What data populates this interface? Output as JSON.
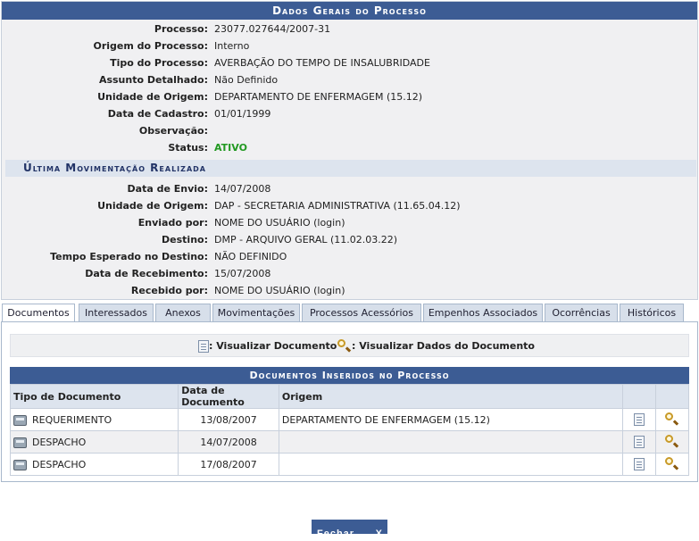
{
  "panel": {
    "title": "Dados Gerais do Processo",
    "fields": [
      {
        "label": "Processo:",
        "value": "23077.027644/2007-31"
      },
      {
        "label": "Origem do Processo:",
        "value": "Interno"
      },
      {
        "label": "Tipo do Processo:",
        "value": "AVERBAÇÃO DO TEMPO DE INSALUBRIDADE"
      },
      {
        "label": "Assunto Detalhado:",
        "value": "Não Definido"
      },
      {
        "label": "Unidade de Origem:",
        "value": "DEPARTAMENTO DE ENFERMAGEM (15.12)"
      },
      {
        "label": "Data de Cadastro:",
        "value": "01/01/1999"
      },
      {
        "label": "Observação:",
        "value": ""
      },
      {
        "label": "Status:",
        "value": "ATIVO"
      }
    ],
    "status_color": "#229922",
    "movement": {
      "title": "Última Movimentação Realizada",
      "fields": [
        {
          "label": "Data de Envio:",
          "value": "14/07/2008"
        },
        {
          "label": "Unidade de Origem:",
          "value": "DAP - SECRETARIA ADMINISTRATIVA (11.65.04.12)"
        },
        {
          "label": "Enviado por:",
          "value": "NOME DO USUÁRIO (login)"
        },
        {
          "label": "Destino:",
          "value": "DMP - ARQUIVO GERAL (11.02.03.22)"
        },
        {
          "label": "Tempo Esperado no Destino:",
          "value": "NÃO DEFINIDO"
        },
        {
          "label": "Data de Recebimento:",
          "value": "15/07/2008"
        },
        {
          "label": "Recebido por:",
          "value": "NOME DO USUÁRIO (login)"
        }
      ]
    }
  },
  "tabs": [
    {
      "label": "Documentos",
      "active": true
    },
    {
      "label": "Interessados"
    },
    {
      "label": "Anexos"
    },
    {
      "label": "Movimentações"
    },
    {
      "label": "Processos Acessórios"
    },
    {
      "label": "Empenhos Associados"
    },
    {
      "label": "Ocorrências"
    },
    {
      "label": "Históricos"
    }
  ],
  "legend": {
    "view_document": ": Visualizar Documento",
    "view_data": ": Visualizar Dados do Documento"
  },
  "documents": {
    "title": "Documentos Inseridos no Processo",
    "columns": [
      "Tipo de Documento",
      "Data de Documento",
      "Origem"
    ],
    "rows": [
      {
        "tipo": "REQUERIMENTO",
        "data": "13/08/2007",
        "origem": "DEPARTAMENTO DE ENFERMAGEM (15.12)"
      },
      {
        "tipo": "DESPACHO",
        "data": "14/07/2008",
        "origem": ""
      },
      {
        "tipo": "DESPACHO",
        "data": "17/08/2007",
        "origem": ""
      }
    ]
  },
  "close_button": {
    "label": "Fechar",
    "icon": "X"
  },
  "colors": {
    "header_bg": "#3c5c94",
    "panel_bg": "#f0f0f2",
    "subheader_bg": "#dde4ee"
  }
}
